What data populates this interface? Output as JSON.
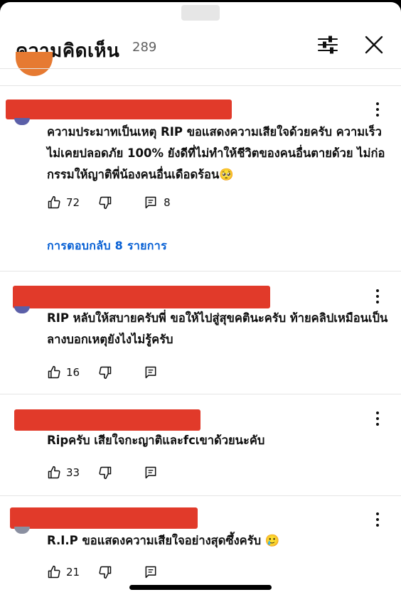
{
  "header": {
    "title": "ความคิดเห็น",
    "count": "289"
  },
  "comments": [
    {
      "text": "ความประมาทเป็นเหตุ RIP ขอแสดงความเสียใจด้วยครับ ความเร็วไม่เคยปลอดภัย 100% ยังดีที่ไม่ทำให้ชีวิตของคนอื่นตายด้วย ไม่ก่อกรรมให้ญาติพี่น้องคนอื่นเดือดร้อน🥺",
      "likes": "72",
      "replies_count": "8",
      "replies_link": "การตอบกลับ 8 รายการ"
    },
    {
      "text": "RIP หลับให้สบายครับพี่ ขอให้ไปสู่สุขคตินะครับ ท้ายคลิปเหมือนเป็นลางบอกเหตุยังไงไม่รู้ครับ",
      "likes": "16"
    },
    {
      "text": "Ripครับ เสียใจกะญาติและfcเขาด้วยนะคับ",
      "likes": "33"
    },
    {
      "text": "R.I.P ขอแสดงความเสียใจอย่างสุดซึ้งครับ 🥲",
      "likes": "21"
    }
  ],
  "colors": {
    "redaction": "#e13a2a",
    "link": "#065fd4",
    "avatar_previous": "#e67a32"
  },
  "icons": {
    "filter": "filter-sliders-icon",
    "close": "close-icon",
    "more": "more-vertical-icon",
    "like": "thumbs-up-icon",
    "dislike": "thumbs-down-icon",
    "reply": "comment-reply-icon"
  }
}
